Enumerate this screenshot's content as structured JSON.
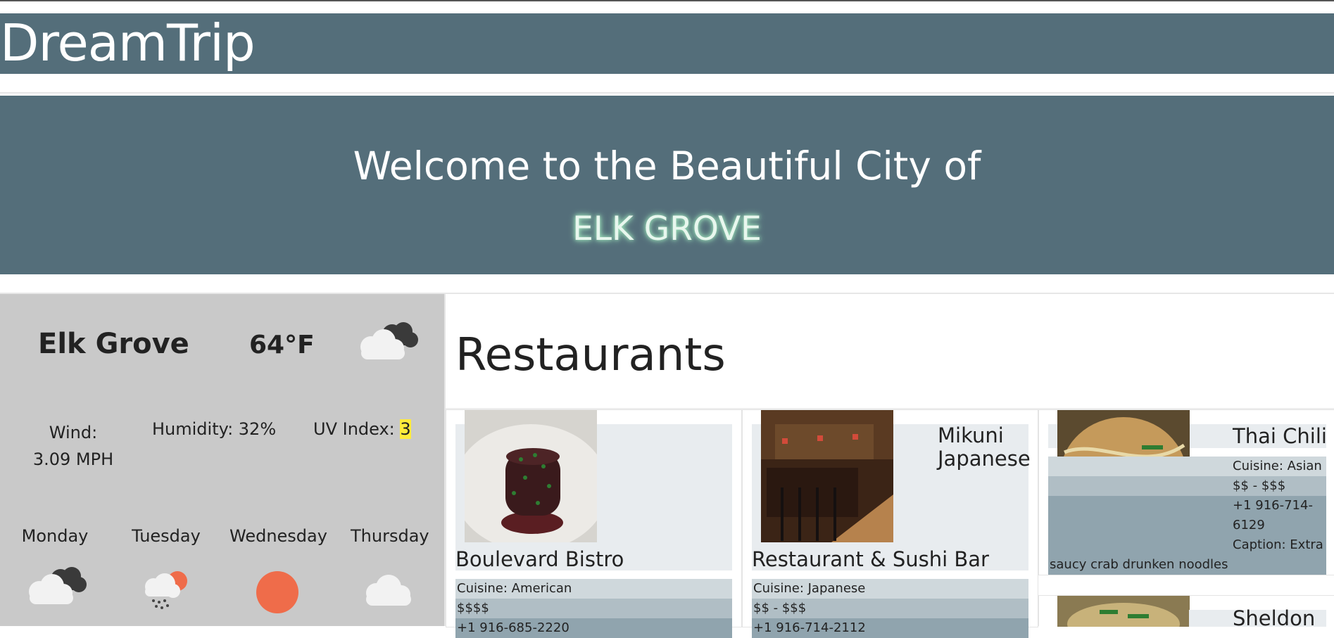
{
  "brand": {
    "title": "DreamTrip"
  },
  "hero": {
    "welcome": "Welcome to the Beautiful City of",
    "city": "ELK GROVE"
  },
  "weather": {
    "city": "Elk Grove",
    "temp": "64°F",
    "current_icon": "partly-cloudy-icon",
    "wind_label": "Wind: 3.09 MPH",
    "humidity_label": "Humidity: 32%",
    "uv_label": "UV Index: ",
    "uv_value": "3",
    "forecast": [
      {
        "day": "Monday",
        "icon": "cloudy-icon"
      },
      {
        "day": "Tuesday",
        "icon": "rain-sun-icon"
      },
      {
        "day": "Wednesday",
        "icon": "sun-icon"
      },
      {
        "day": "Thursday",
        "icon": "cloud-icon"
      }
    ],
    "colors": {
      "sun": "#ef6c4a",
      "panel": "#c9c9c9",
      "uv_highlight": "#ffeb3b"
    }
  },
  "restaurants": {
    "heading": "Restaurants",
    "cards": [
      {
        "name": "Boulevard Bistro",
        "cuisine": "Cuisine: American",
        "price": "$$$$",
        "phone": "+1 916-685-2220"
      },
      {
        "name_line1": "Mikuni",
        "name_line2": "Japanese",
        "name_line3": "Restaurant & Sushi Bar",
        "cuisine": "Cuisine: Japanese",
        "price": "$$ - $$$",
        "phone": "+1 916-714-2112"
      },
      {
        "name": "Thai Chili",
        "cuisine": "Cuisine: Asian",
        "price": "$$ - $$$",
        "phone_line1": "+1 916-714-",
        "phone_line2": "6129",
        "caption_line1": "Caption: Extra",
        "caption_line2": "saucy crab drunken noodles"
      },
      {
        "name": "Sheldon"
      }
    ]
  },
  "theme": {
    "header": "#546e7a",
    "accent_glow": "#9fe7bc"
  }
}
